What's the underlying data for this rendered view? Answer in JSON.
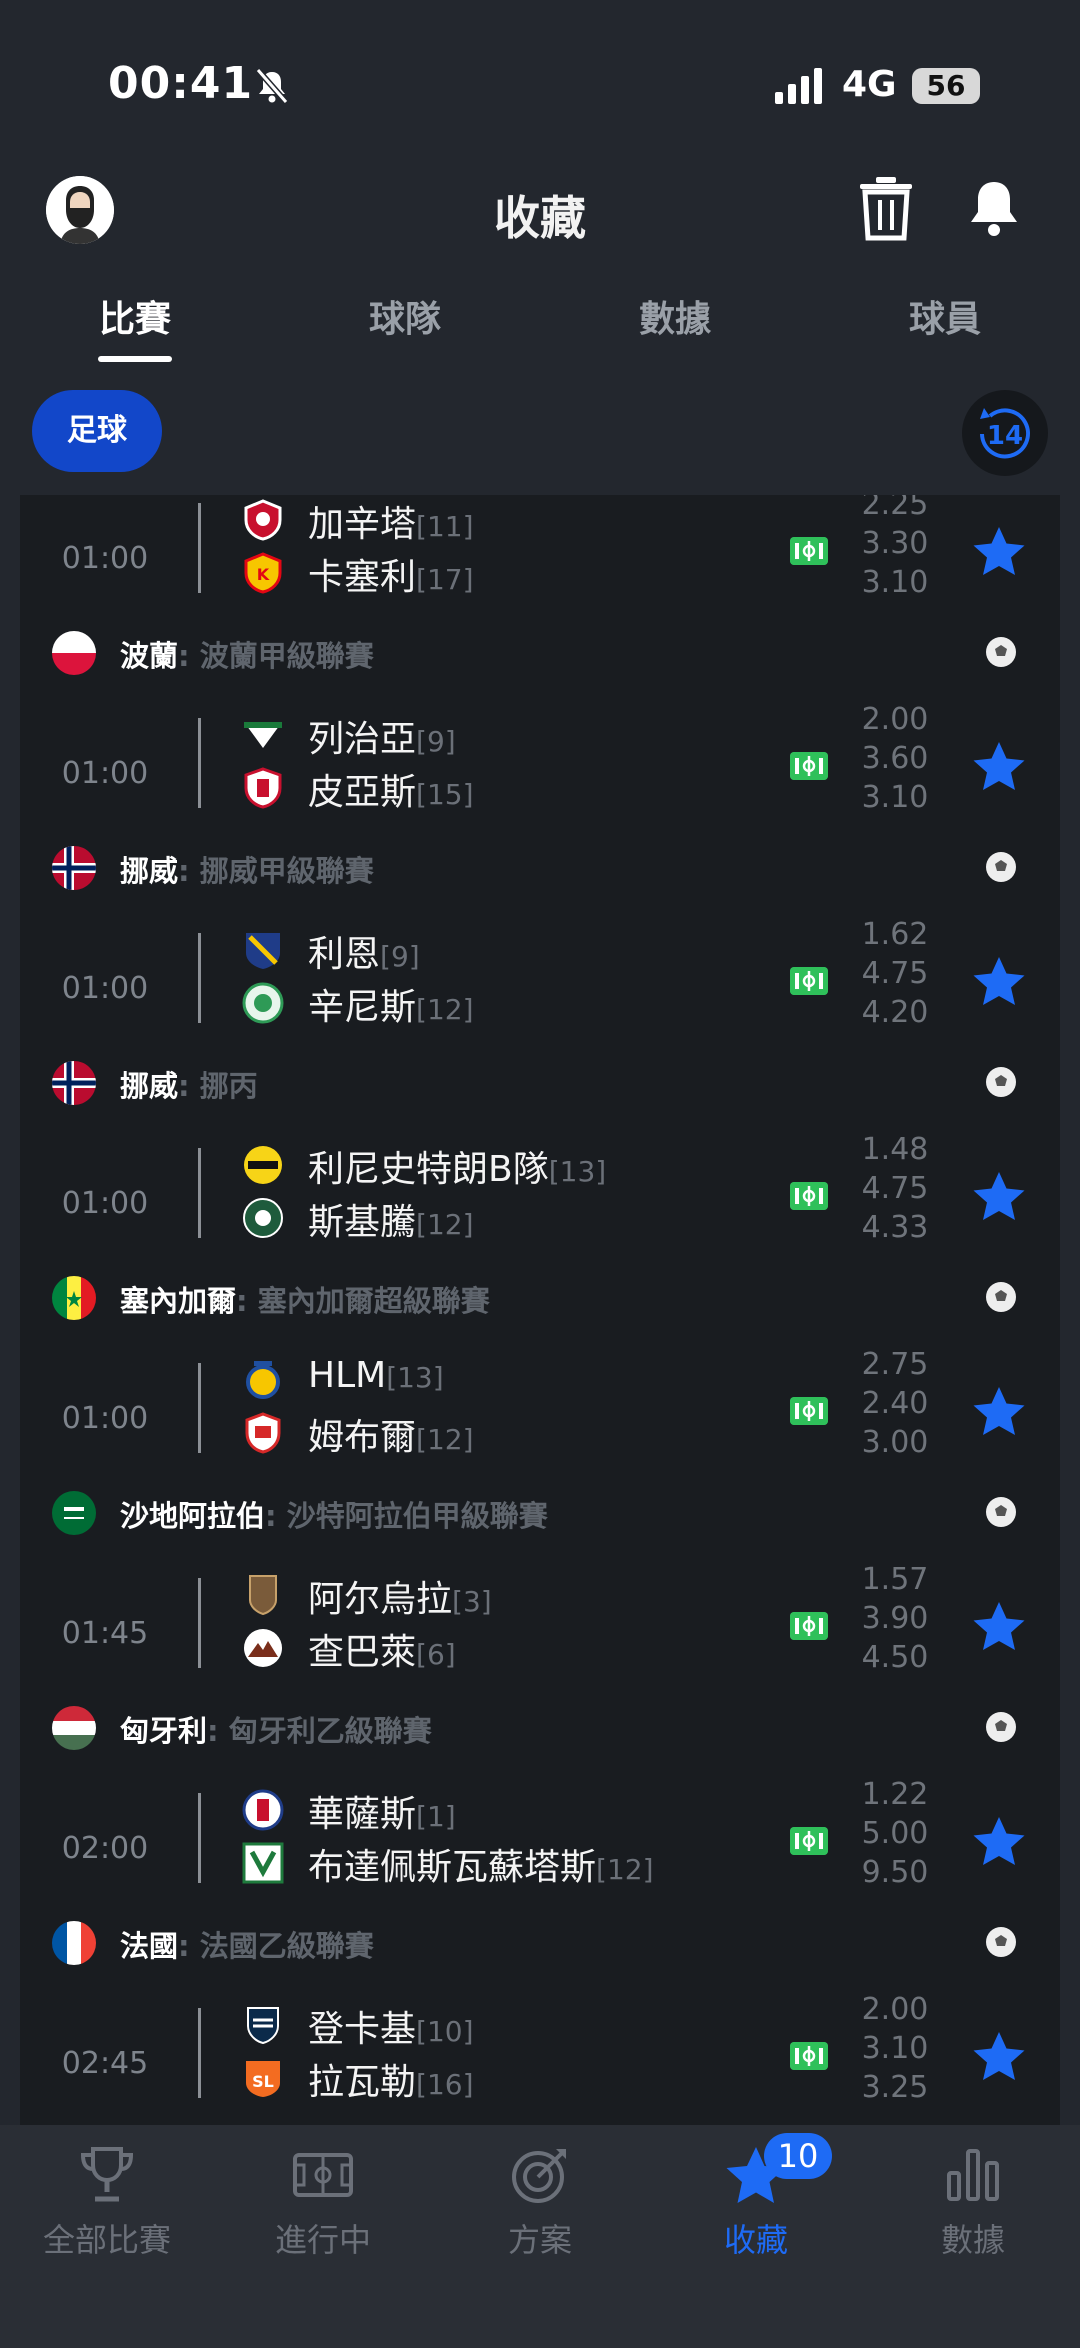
{
  "status": {
    "time": "00:41",
    "network": "4G",
    "battery": "56"
  },
  "header": {
    "title": "收藏"
  },
  "tabs": [
    {
      "label": "比賽",
      "active": true
    },
    {
      "label": "球隊",
      "active": false
    },
    {
      "label": "數據",
      "active": false
    },
    {
      "label": "球員",
      "active": false
    }
  ],
  "filter": {
    "sport_label": "足球",
    "history_days": "14"
  },
  "leagues": [
    {
      "country": "",
      "league": "",
      "flag": "none",
      "match": {
        "time": "01:00",
        "home": "加辛塔",
        "home_rank": "[11]",
        "away": "卡塞利",
        "away_rank": "[17]",
        "odds": [
          "2.25",
          "3.30",
          "3.10"
        ]
      }
    },
    {
      "country": "波蘭",
      "league": ": 波蘭甲級聯賽",
      "flag": "poland",
      "match": {
        "time": "01:00",
        "home": "列治亞",
        "home_rank": "[9]",
        "away": "皮亞斯",
        "away_rank": "[15]",
        "odds": [
          "2.00",
          "3.60",
          "3.10"
        ]
      }
    },
    {
      "country": "挪威",
      "league": ": 挪威甲級聯賽",
      "flag": "norway",
      "match": {
        "time": "01:00",
        "home": "利恩",
        "home_rank": "[9]",
        "away": "辛尼斯",
        "away_rank": "[12]",
        "odds": [
          "1.62",
          "4.75",
          "4.20"
        ]
      }
    },
    {
      "country": "挪威",
      "league": ": 挪丙",
      "flag": "norway",
      "match": {
        "time": "01:00",
        "home": "利尼史特朗B隊",
        "home_rank": "[13]",
        "away": "斯基騰",
        "away_rank": "[12]",
        "odds": [
          "1.48",
          "4.75",
          "4.33"
        ]
      }
    },
    {
      "country": "塞內加爾",
      "league": ": 塞內加爾超級聯賽",
      "flag": "senegal",
      "match": {
        "time": "01:00",
        "home": "HLM",
        "home_rank": "[13]",
        "away": "姆布爾",
        "away_rank": "[12]",
        "odds": [
          "2.75",
          "2.40",
          "3.00"
        ]
      }
    },
    {
      "country": "沙地阿拉伯",
      "league": ": 沙特阿拉伯甲級聯賽",
      "flag": "saudi",
      "match": {
        "time": "01:45",
        "home": "阿尔烏拉",
        "home_rank": "[3]",
        "away": "查巴萊",
        "away_rank": "[6]",
        "odds": [
          "1.57",
          "3.90",
          "4.50"
        ]
      }
    },
    {
      "country": "匈牙利",
      "league": ": 匈牙利乙級聯賽",
      "flag": "hungary",
      "match": {
        "time": "02:00",
        "home": "華薩斯",
        "home_rank": "[1]",
        "away": "布達佩斯瓦蘇塔斯",
        "away_rank": "[12]",
        "odds": [
          "1.22",
          "5.00",
          "9.50"
        ]
      }
    },
    {
      "country": "法國",
      "league": ": 法國乙級聯賽",
      "flag": "france",
      "match": {
        "time": "02:45",
        "home": "登卡基",
        "home_rank": "[10]",
        "away": "拉瓦勒",
        "away_rank": "[16]",
        "odds": [
          "2.00",
          "3.10",
          "3.25"
        ]
      }
    }
  ],
  "nav": [
    {
      "label": "全部比賽",
      "icon": "trophy-icon",
      "active": false
    },
    {
      "label": "進行中",
      "icon": "pitch-icon",
      "active": false
    },
    {
      "label": "方案",
      "icon": "target-icon",
      "active": false
    },
    {
      "label": "收藏",
      "icon": "star-icon",
      "active": true,
      "badge": "10"
    },
    {
      "label": "數據",
      "icon": "bar-chart-icon",
      "active": false
    }
  ],
  "colors": {
    "accent": "#1e6bf5",
    "chip": "#1247c9",
    "live": "#2fc05a",
    "background": "#23272e",
    "list_bg": "#191c20"
  }
}
